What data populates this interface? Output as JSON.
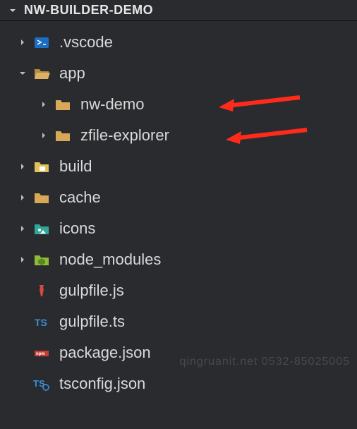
{
  "header": {
    "title": "NW-BUILDER-DEMO"
  },
  "tree": [
    {
      "label": ".vscode",
      "icon": "vscode",
      "collapsed": true,
      "indent": 0,
      "hasChildren": true
    },
    {
      "label": "app",
      "icon": "folder-open",
      "collapsed": false,
      "indent": 0,
      "hasChildren": true
    },
    {
      "label": "nw-demo",
      "icon": "folder",
      "collapsed": true,
      "indent": 1,
      "hasChildren": true,
      "arrow": true
    },
    {
      "label": "zfile-explorer",
      "icon": "folder",
      "collapsed": true,
      "indent": 1,
      "hasChildren": true,
      "arrow": true
    },
    {
      "label": "build",
      "icon": "build",
      "collapsed": true,
      "indent": 0,
      "hasChildren": true
    },
    {
      "label": "cache",
      "icon": "folder",
      "collapsed": true,
      "indent": 0,
      "hasChildren": true
    },
    {
      "label": "icons",
      "icon": "icons",
      "collapsed": true,
      "indent": 0,
      "hasChildren": true
    },
    {
      "label": "node_modules",
      "icon": "nodemods",
      "collapsed": true,
      "indent": 0,
      "hasChildren": true
    },
    {
      "label": "gulpfile.js",
      "icon": "gulp",
      "indent": 0,
      "hasChildren": false
    },
    {
      "label": "gulpfile.ts",
      "icon": "ts",
      "indent": 0,
      "hasChildren": false
    },
    {
      "label": "package.json",
      "icon": "npm",
      "indent": 0,
      "hasChildren": false
    },
    {
      "label": "tsconfig.json",
      "icon": "tsconfig",
      "indent": 0,
      "hasChildren": false
    }
  ],
  "watermark": "qingruanit.net 0532-85025005"
}
